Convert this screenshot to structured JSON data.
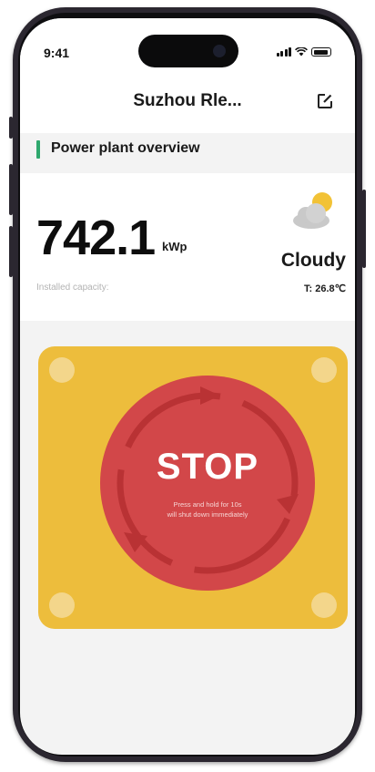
{
  "status_bar": {
    "time": "9:41"
  },
  "header": {
    "title": "Suzhou Rle...",
    "edit_icon": "edit-icon"
  },
  "section": {
    "title": "Power plant overview",
    "accent": "#2fa86e"
  },
  "capacity": {
    "value": "742.1",
    "unit": "kWp",
    "label": "Installed capacity:"
  },
  "weather": {
    "condition": "Cloudy",
    "temperature": "T:  26.8℃",
    "icon": "partly-cloudy-icon"
  },
  "stop_button": {
    "label": "STOP",
    "instruction_line1": "Press and hold for 10s",
    "instruction_line2": "will shut down immediately",
    "panel_color": "#edbd3c",
    "button_color": "#d24749"
  }
}
